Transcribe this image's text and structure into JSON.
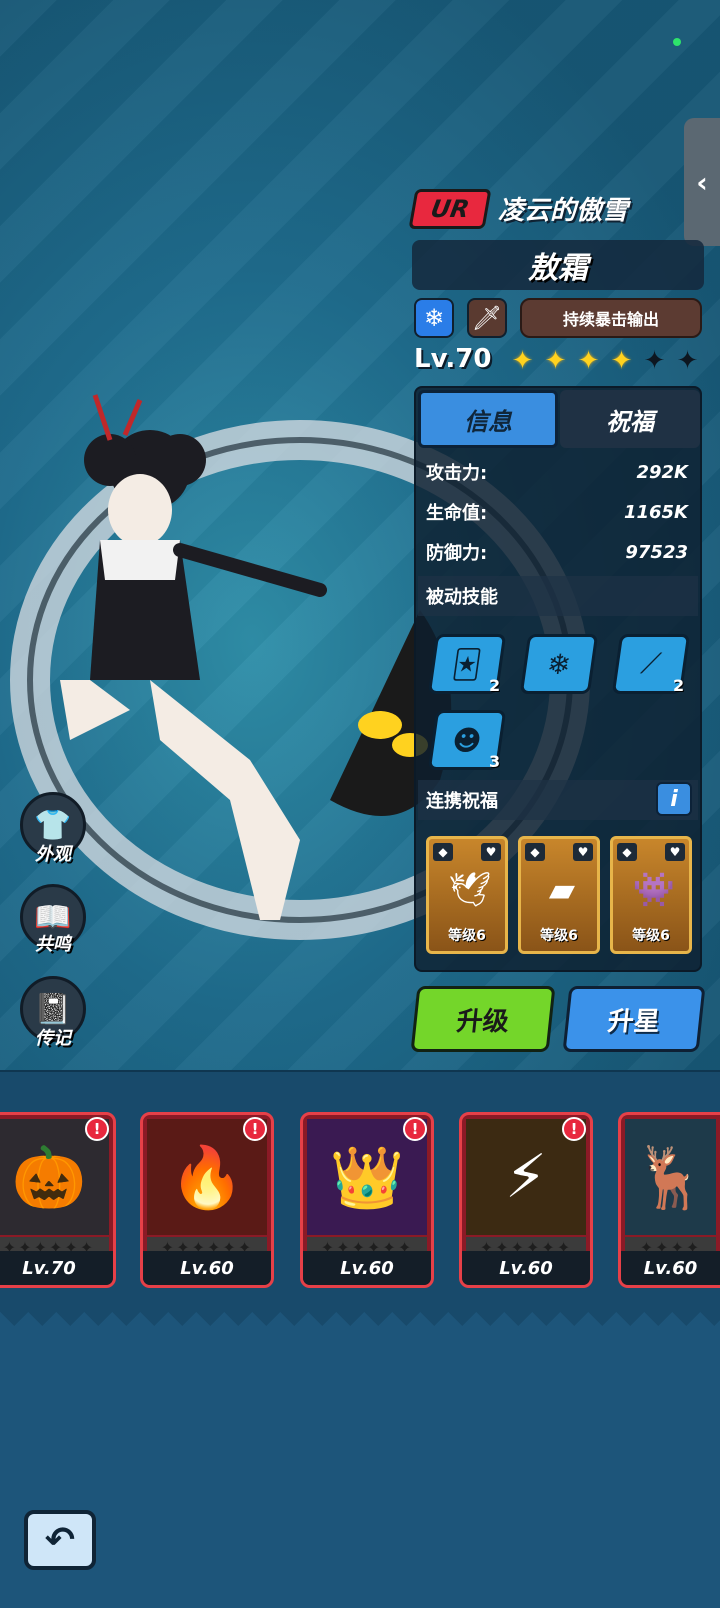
{
  "header": {
    "rarity": "UR",
    "subtitle": "凌云的傲雪",
    "name": "敖霜",
    "role": "持续暴击输出",
    "level": "Lv.70",
    "stars_on": 4,
    "stars_total": 6
  },
  "tabs": {
    "info": "信息",
    "bless": "祝福"
  },
  "stats": [
    {
      "label": "攻击力:",
      "value": "292K"
    },
    {
      "label": "生命值:",
      "value": "1165K"
    },
    {
      "label": "防御力:",
      "value": "97523"
    }
  ],
  "passive": {
    "title": "被动技能",
    "skills": [
      {
        "icon": "card-skill-icon",
        "count": "2"
      },
      {
        "icon": "snowflake-skill-icon",
        "count": ""
      },
      {
        "icon": "claw-skill-icon",
        "count": "2"
      },
      {
        "icon": "demon-skill-icon",
        "count": "3"
      }
    ]
  },
  "link_bless": {
    "title": "连携祝福",
    "info": "i",
    "cards": [
      {
        "icon": "winged-emblem-icon",
        "level": "等级6"
      },
      {
        "icon": "gold-bars-icon",
        "level": "等级6"
      },
      {
        "icon": "demon-pet-icon",
        "level": "等级6"
      }
    ]
  },
  "buttons": {
    "upgrade": "升级",
    "star_up": "升星"
  },
  "side": [
    {
      "label": "外观",
      "icon": "shirt-icon"
    },
    {
      "label": "共鸣",
      "icon": "book-icon"
    },
    {
      "label": "传记",
      "icon": "journal-icon"
    }
  ],
  "heroes": [
    {
      "level": "Lv.70"
    },
    {
      "level": "Lv.60"
    },
    {
      "level": "Lv.60"
    },
    {
      "level": "Lv.60"
    },
    {
      "level": "Lv.60"
    }
  ],
  "colors": {
    "rarity": "#e8283e",
    "upgrade": "#74d62a",
    "star_up": "#3b92ea",
    "star": "#ffd21f"
  }
}
